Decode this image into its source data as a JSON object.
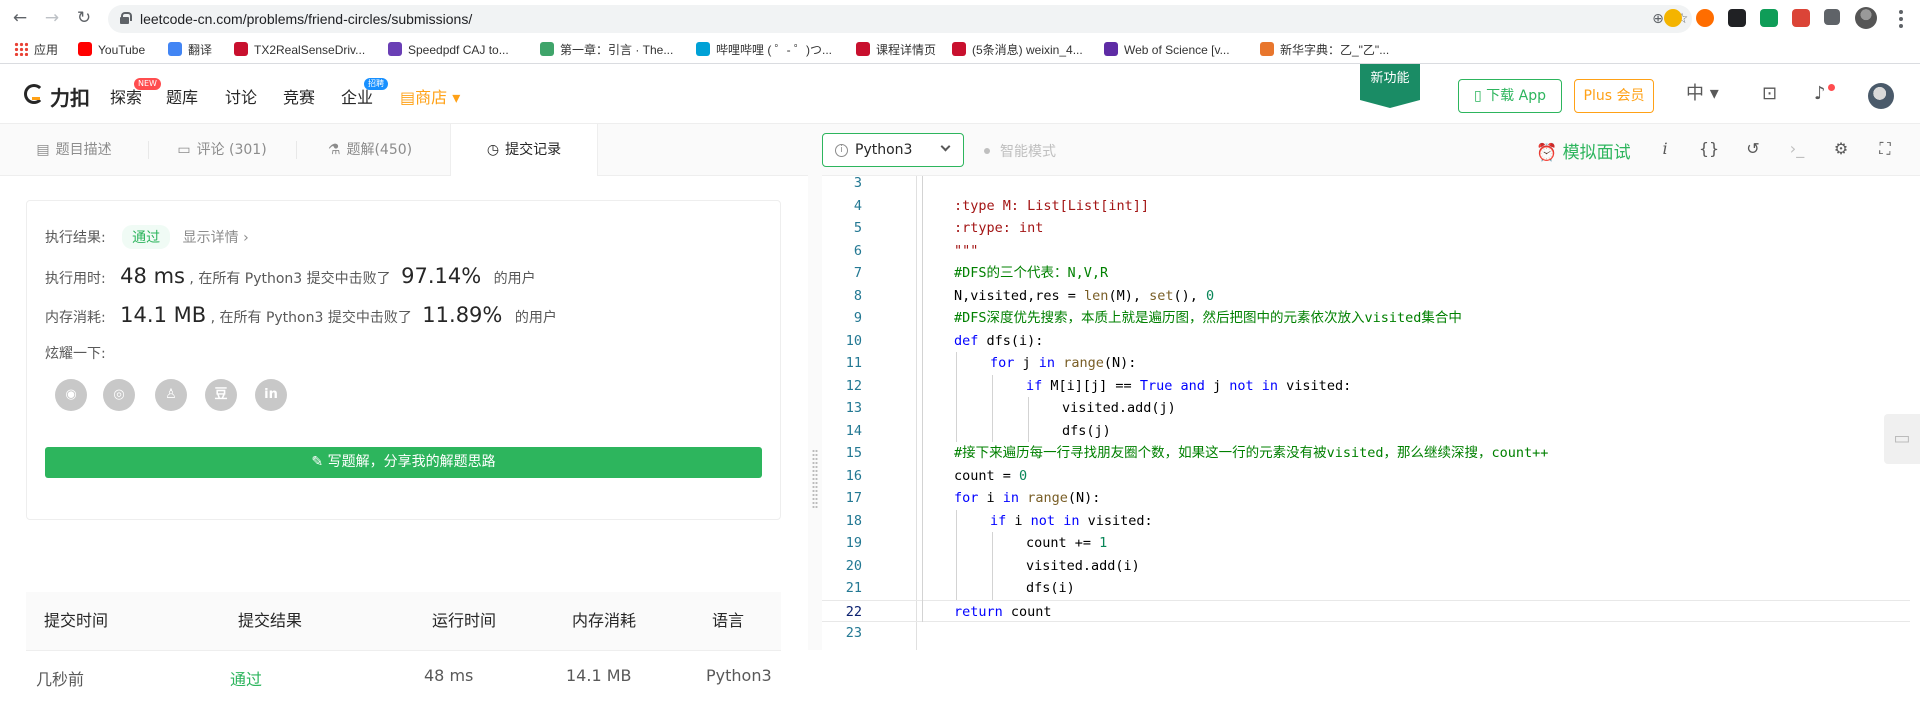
{
  "browser": {
    "url": "leetcode-cn.com/problems/friend-circles/submissions/",
    "bookmarks": [
      {
        "label": "应用",
        "color": "#e94235"
      },
      {
        "label": "YouTube",
        "color": "#ff0000"
      },
      {
        "label": "翻译",
        "color": "#4285f4"
      },
      {
        "label": "TX2RealSenseDriv...",
        "color": "#c8102e"
      },
      {
        "label": "Speedpdf CAJ to...",
        "color": "#6a3fb5"
      },
      {
        "label": "第一章：引言 · The...",
        "color": "#3fa46a"
      },
      {
        "label": "哔哩哔哩 ( ゜- ゜)つ...",
        "color": "#00a1d6"
      },
      {
        "label": "课程详情页",
        "color": "#c8102e"
      },
      {
        "label": "(5条消息) weixin_4...",
        "color": "#c8102e"
      },
      {
        "label": "Web of Science [v...",
        "color": "#5e2ca5"
      },
      {
        "label": "新华字典：乙_\"乙\"...",
        "color": "#e8762d"
      }
    ]
  },
  "header": {
    "logo": "力扣",
    "nav": [
      "探索",
      "题库",
      "讨论",
      "竞赛",
      "企业"
    ],
    "shop": "商店",
    "badge_new": "NEW",
    "badge_hire": "招聘",
    "new_feature": "新功能",
    "download_app": "下载 App",
    "plus": "Plus 会员",
    "lang": "中"
  },
  "tabs": [
    "题目描述",
    "评论 (301)",
    "题解(450)",
    "提交记录"
  ],
  "result": {
    "label": "执行结果:",
    "status": "通过",
    "details": "显示详情 ›",
    "time_label": "执行用时:",
    "time_value": "48 ms",
    "time_desc": ", 在所有 Python3 提交中击败了",
    "time_pct": "97.14%",
    "users": "的用户",
    "mem_label": "内存消耗:",
    "mem_value": "14.1 MB",
    "mem_desc": ", 在所有 Python3 提交中击败了",
    "mem_pct": "11.89%",
    "share_label": "炫耀一下:",
    "share_icons": [
      "wechat-icon",
      "weibo-icon",
      "qq-icon",
      "douban-icon",
      "linkedin-icon"
    ],
    "write_button": "写题解，分享我的解题思路"
  },
  "table": {
    "headers": [
      "提交时间",
      "提交结果",
      "运行时间",
      "内存消耗",
      "语言"
    ],
    "rows": [
      {
        "time": "几秒前",
        "result": "通过",
        "runtime": "48 ms",
        "memory": "14.1 MB",
        "lang": "Python3"
      }
    ]
  },
  "editor": {
    "language": "Python3",
    "smart_mode": "智能模式",
    "mock_interview": "模拟面试",
    "lines": [
      {
        "n": "3",
        "indent": 2,
        "code": ""
      },
      {
        "n": "4",
        "indent": 2,
        "code": ":type M: List[List[int]]"
      },
      {
        "n": "5",
        "indent": 2,
        "code": ":rtype: int"
      },
      {
        "n": "6",
        "indent": 2,
        "code": "\"\"\""
      },
      {
        "n": "7",
        "indent": 2,
        "code": "#DFS的三个代表：N,V,R"
      },
      {
        "n": "8",
        "indent": 2,
        "code": "N,visited,res = len(M), set(), 0"
      },
      {
        "n": "9",
        "indent": 2,
        "code": "#DFS深度优先搜索，本质上就是遍历图，然后把图中的元素依次放入visited集合中"
      },
      {
        "n": "10",
        "indent": 2,
        "code": "def dfs(i):"
      },
      {
        "n": "11",
        "indent": 3,
        "code": "for j in range(N):"
      },
      {
        "n": "12",
        "indent": 4,
        "code": "if M[i][j] == True and j not in visited:"
      },
      {
        "n": "13",
        "indent": 5,
        "code": "visited.add(j)"
      },
      {
        "n": "14",
        "indent": 5,
        "code": "dfs(j)"
      },
      {
        "n": "15",
        "indent": 2,
        "code": "#接下来遍历每一行寻找朋友圈个数，如果这一行的元素没有被visited，那么继续深搜，count++"
      },
      {
        "n": "16",
        "indent": 2,
        "code": "count = 0"
      },
      {
        "n": "17",
        "indent": 2,
        "code": "for i in range(N):"
      },
      {
        "n": "18",
        "indent": 3,
        "code": "if i not in visited:"
      },
      {
        "n": "19",
        "indent": 4,
        "code": "count += 1"
      },
      {
        "n": "20",
        "indent": 4,
        "code": "visited.add(i)"
      },
      {
        "n": "21",
        "indent": 4,
        "code": "dfs(i)"
      },
      {
        "n": "22",
        "indent": 2,
        "code": "return count"
      },
      {
        "n": "23",
        "indent": 0,
        "code": ""
      }
    ],
    "current_line": "22"
  },
  "colors": {
    "accent_green": "#2db55d",
    "brand_orange": "#ffa116",
    "plus_orange": "#ffa116"
  }
}
